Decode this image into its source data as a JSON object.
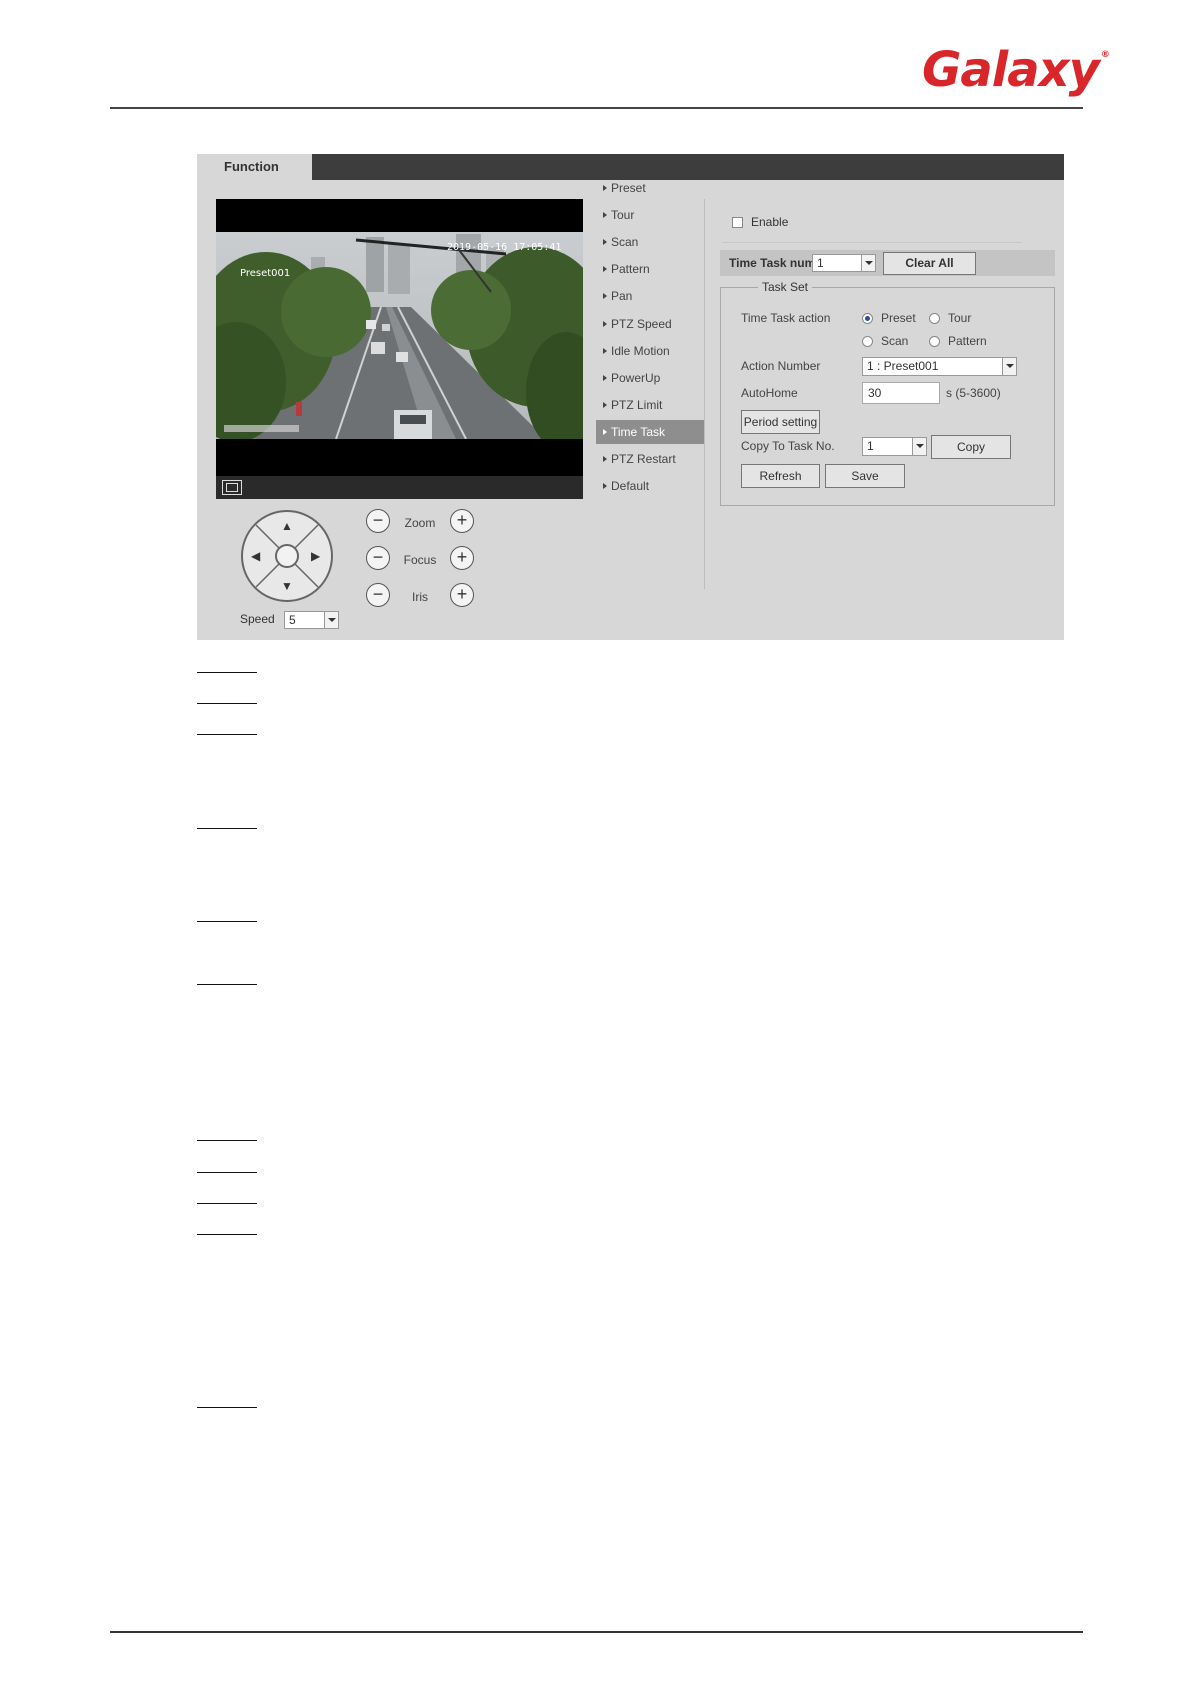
{
  "brand": {
    "logo_text": "Galaxy",
    "registered": "®"
  },
  "panel": {
    "tab_label": "Function"
  },
  "video": {
    "timestamp": "2019-05-16 17:05:41",
    "preset_overlay": "Preset001"
  },
  "ptz": {
    "speed_label": "Speed",
    "speed_value": "5",
    "zoom_label": "Zoom",
    "focus_label": "Focus",
    "iris_label": "Iris",
    "minus_glyph": "−",
    "plus_glyph": "+"
  },
  "menu": {
    "items": [
      "Preset",
      "Tour",
      "Scan",
      "Pattern",
      "Pan",
      "PTZ Speed",
      "Idle Motion",
      "PowerUp",
      "PTZ Limit",
      "Time Task",
      "PTZ Restart",
      "Default"
    ],
    "active": "Time Task"
  },
  "time_task": {
    "enable_label": "Enable",
    "task_num_label": "Time Task num",
    "task_num_value": "1",
    "clear_all_label": "Clear All",
    "task_set_legend": "Task Set",
    "action_label": "Time Task action",
    "actions": {
      "preset": "Preset",
      "tour": "Tour",
      "scan": "Scan",
      "pattern": "Pattern"
    },
    "selected_action": "Preset",
    "action_number_label": "Action Number",
    "action_number_value": "1 : Preset001",
    "autohome_label": "AutoHome",
    "autohome_value": "30",
    "autohome_unit": "s (5-3600)",
    "period_setting_label": "Period setting",
    "copy_to_label": "Copy To Task No.",
    "copy_to_value": "1",
    "copy_label": "Copy",
    "refresh_label": "Refresh",
    "save_label": "Save"
  }
}
